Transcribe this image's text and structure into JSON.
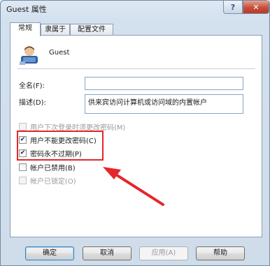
{
  "window": {
    "title": "Guest 属性",
    "help": "?",
    "close": "✕"
  },
  "tabs": [
    "常规",
    "隶属于",
    "配置文件"
  ],
  "user": {
    "name": "Guest"
  },
  "fields": {
    "fullname_label": "全名(F):",
    "fullname_value": "",
    "desc_label": "描述(D):",
    "desc_value": "供来宾访问计算机或访问域的内置帐户"
  },
  "checkboxes": [
    {
      "label": "用户下次登录时须更改密码(M)",
      "checked": false,
      "disabled": true
    },
    {
      "label": "用户不能更改密码(C)",
      "checked": true,
      "disabled": false
    },
    {
      "label": "密码永不过期(P)",
      "checked": true,
      "disabled": false
    },
    {
      "label": "帐户已禁用(B)",
      "checked": false,
      "disabled": false
    },
    {
      "label": "帐户已锁定(O)",
      "checked": false,
      "disabled": true
    }
  ],
  "buttons": {
    "ok": "确定",
    "cancel": "取消",
    "apply": "应用(A)",
    "help": "帮助"
  },
  "colors": {
    "highlight": "#e5262a",
    "accent": "#3c7fb1"
  }
}
